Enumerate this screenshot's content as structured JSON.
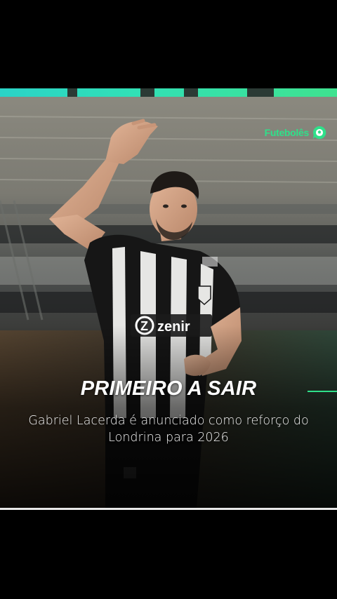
{
  "post": {
    "brand_name": "Futebolês",
    "brand_color": "#2fe08a",
    "headline": "PRIMEIRO A SAIR",
    "subtitle": "Gabriel Lacerda é anunciado como reforço do Londrina para 2026",
    "photo": {
      "description_icon": "football-player-photo",
      "jersey_sponsor": "zenir"
    }
  }
}
